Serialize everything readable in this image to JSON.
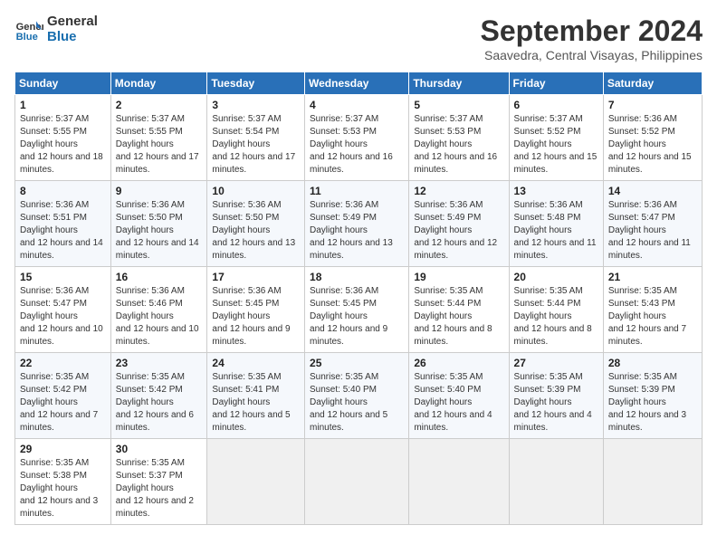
{
  "header": {
    "logo_line1": "General",
    "logo_line2": "Blue",
    "title": "September 2024",
    "subtitle": "Saavedra, Central Visayas, Philippines"
  },
  "calendar": {
    "days_of_week": [
      "Sunday",
      "Monday",
      "Tuesday",
      "Wednesday",
      "Thursday",
      "Friday",
      "Saturday"
    ],
    "weeks": [
      [
        {
          "day": "",
          "info": ""
        },
        {
          "day": "",
          "info": ""
        },
        {
          "day": "",
          "info": ""
        },
        {
          "day": "",
          "info": ""
        },
        {
          "day": "",
          "info": ""
        },
        {
          "day": "",
          "info": ""
        },
        {
          "day": "",
          "info": ""
        }
      ],
      [
        {
          "day": "1",
          "sunrise": "5:37 AM",
          "sunset": "5:55 PM",
          "daylight": "12 hours and 18 minutes."
        },
        {
          "day": "2",
          "sunrise": "5:37 AM",
          "sunset": "5:55 PM",
          "daylight": "12 hours and 17 minutes."
        },
        {
          "day": "3",
          "sunrise": "5:37 AM",
          "sunset": "5:54 PM",
          "daylight": "12 hours and 17 minutes."
        },
        {
          "day": "4",
          "sunrise": "5:37 AM",
          "sunset": "5:53 PM",
          "daylight": "12 hours and 16 minutes."
        },
        {
          "day": "5",
          "sunrise": "5:37 AM",
          "sunset": "5:53 PM",
          "daylight": "12 hours and 16 minutes."
        },
        {
          "day": "6",
          "sunrise": "5:37 AM",
          "sunset": "5:52 PM",
          "daylight": "12 hours and 15 minutes."
        },
        {
          "day": "7",
          "sunrise": "5:36 AM",
          "sunset": "5:52 PM",
          "daylight": "12 hours and 15 minutes."
        }
      ],
      [
        {
          "day": "8",
          "sunrise": "5:36 AM",
          "sunset": "5:51 PM",
          "daylight": "12 hours and 14 minutes."
        },
        {
          "day": "9",
          "sunrise": "5:36 AM",
          "sunset": "5:50 PM",
          "daylight": "12 hours and 14 minutes."
        },
        {
          "day": "10",
          "sunrise": "5:36 AM",
          "sunset": "5:50 PM",
          "daylight": "12 hours and 13 minutes."
        },
        {
          "day": "11",
          "sunrise": "5:36 AM",
          "sunset": "5:49 PM",
          "daylight": "12 hours and 13 minutes."
        },
        {
          "day": "12",
          "sunrise": "5:36 AM",
          "sunset": "5:49 PM",
          "daylight": "12 hours and 12 minutes."
        },
        {
          "day": "13",
          "sunrise": "5:36 AM",
          "sunset": "5:48 PM",
          "daylight": "12 hours and 11 minutes."
        },
        {
          "day": "14",
          "sunrise": "5:36 AM",
          "sunset": "5:47 PM",
          "daylight": "12 hours and 11 minutes."
        }
      ],
      [
        {
          "day": "15",
          "sunrise": "5:36 AM",
          "sunset": "5:47 PM",
          "daylight": "12 hours and 10 minutes."
        },
        {
          "day": "16",
          "sunrise": "5:36 AM",
          "sunset": "5:46 PM",
          "daylight": "12 hours and 10 minutes."
        },
        {
          "day": "17",
          "sunrise": "5:36 AM",
          "sunset": "5:45 PM",
          "daylight": "12 hours and 9 minutes."
        },
        {
          "day": "18",
          "sunrise": "5:36 AM",
          "sunset": "5:45 PM",
          "daylight": "12 hours and 9 minutes."
        },
        {
          "day": "19",
          "sunrise": "5:35 AM",
          "sunset": "5:44 PM",
          "daylight": "12 hours and 8 minutes."
        },
        {
          "day": "20",
          "sunrise": "5:35 AM",
          "sunset": "5:44 PM",
          "daylight": "12 hours and 8 minutes."
        },
        {
          "day": "21",
          "sunrise": "5:35 AM",
          "sunset": "5:43 PM",
          "daylight": "12 hours and 7 minutes."
        }
      ],
      [
        {
          "day": "22",
          "sunrise": "5:35 AM",
          "sunset": "5:42 PM",
          "daylight": "12 hours and 7 minutes."
        },
        {
          "day": "23",
          "sunrise": "5:35 AM",
          "sunset": "5:42 PM",
          "daylight": "12 hours and 6 minutes."
        },
        {
          "day": "24",
          "sunrise": "5:35 AM",
          "sunset": "5:41 PM",
          "daylight": "12 hours and 5 minutes."
        },
        {
          "day": "25",
          "sunrise": "5:35 AM",
          "sunset": "5:40 PM",
          "daylight": "12 hours and 5 minutes."
        },
        {
          "day": "26",
          "sunrise": "5:35 AM",
          "sunset": "5:40 PM",
          "daylight": "12 hours and 4 minutes."
        },
        {
          "day": "27",
          "sunrise": "5:35 AM",
          "sunset": "5:39 PM",
          "daylight": "12 hours and 4 minutes."
        },
        {
          "day": "28",
          "sunrise": "5:35 AM",
          "sunset": "5:39 PM",
          "daylight": "12 hours and 3 minutes."
        }
      ],
      [
        {
          "day": "29",
          "sunrise": "5:35 AM",
          "sunset": "5:38 PM",
          "daylight": "12 hours and 3 minutes."
        },
        {
          "day": "30",
          "sunrise": "5:35 AM",
          "sunset": "5:37 PM",
          "daylight": "12 hours and 2 minutes."
        },
        {
          "day": "",
          "info": ""
        },
        {
          "day": "",
          "info": ""
        },
        {
          "day": "",
          "info": ""
        },
        {
          "day": "",
          "info": ""
        },
        {
          "day": "",
          "info": ""
        }
      ]
    ]
  }
}
